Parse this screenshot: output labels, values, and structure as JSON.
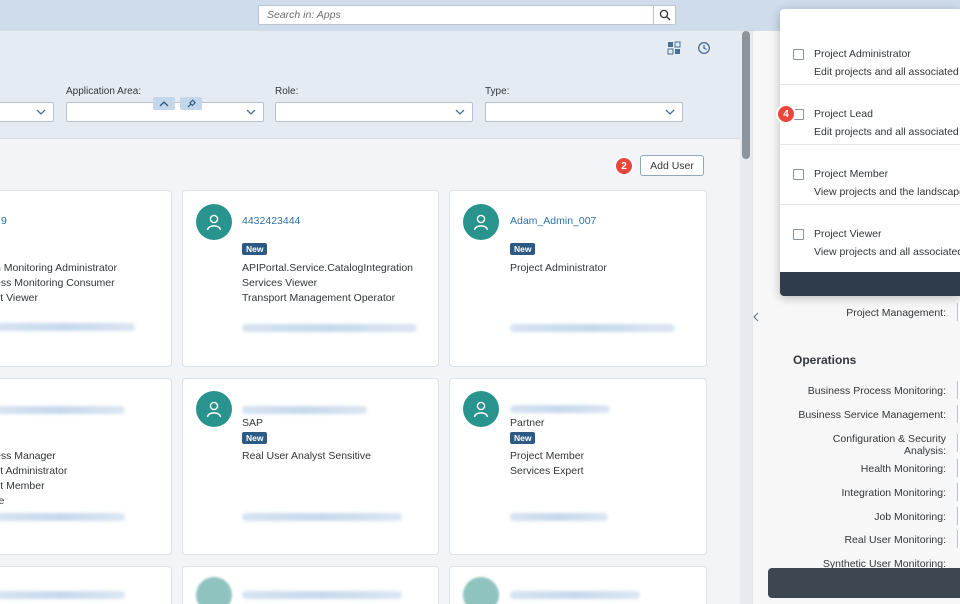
{
  "shell": {
    "search_placeholder": "Search in: Apps"
  },
  "filters": {
    "application_area_label": "Application Area:",
    "role_label": "Role:",
    "type_label": "Type:"
  },
  "toolbar": {
    "add_user_label": "Add User",
    "add_user_step": "2"
  },
  "cards": [
    {
      "name": "9",
      "roles": [
        "h Monitoring Administrator",
        "ess Monitoring Consumer",
        "ct Viewer"
      ]
    },
    {
      "name": "4432423444",
      "badge": "New",
      "roles": [
        "APIPortal.Service.CatalogIntegration",
        "Services Viewer",
        "Transport Management Operator"
      ]
    },
    {
      "name": "Adam_Admin_007",
      "badge": "New",
      "roles": [
        "Project Administrator"
      ]
    },
    {
      "roles": [
        "ess Manager",
        "ct Administrator",
        "ct Member",
        "re"
      ]
    },
    {
      "subtitle": "SAP",
      "badge": "New",
      "roles": [
        "Real User Analyst Sensitive"
      ]
    },
    {
      "subtitle": "Partner",
      "badge": "New",
      "roles": [
        "Project Member",
        "Services Expert"
      ]
    }
  ],
  "popover": {
    "step": "4",
    "items": [
      {
        "title": "Project Administrator",
        "desc": "Edit projects and all associated"
      },
      {
        "title": "Project Lead",
        "desc": "Edit projects and all associated"
      },
      {
        "title": "Project Member",
        "desc": "View projects and the landscape"
      },
      {
        "title": "Project Viewer",
        "desc": "View projects and all associated"
      }
    ]
  },
  "side_panel": {
    "project_management_label": "Project Management:",
    "operations_title": "Operations",
    "operations": [
      "Business Process Monitoring:",
      "Business Service Management:",
      "Configuration & Security Analysis:",
      "Health Monitoring:",
      "Integration Monitoring:",
      "Job Monitoring:",
      "Real User Monitoring:",
      "Synthetic User Monitoring:"
    ]
  },
  "colors": {
    "avatar": "#29938d",
    "badge": "#2c5a85",
    "link": "#2f6fa7",
    "marker": "#e9473b"
  }
}
